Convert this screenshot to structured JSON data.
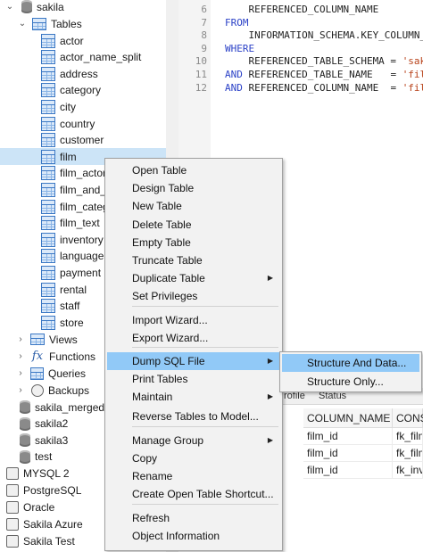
{
  "tree": {
    "db_name": "sakila",
    "tables_label": "Tables",
    "tables": [
      "actor",
      "actor_name_split",
      "address",
      "category",
      "city",
      "country",
      "customer",
      "film",
      "film_actor",
      "film_and_a",
      "film_categ",
      "film_text",
      "inventory",
      "language",
      "payment",
      "rental",
      "staff",
      "store"
    ],
    "views_label": "Views",
    "functions_label": "Functions",
    "queries_label": "Queries",
    "backups_label": "Backups",
    "other_dbs": [
      "sakila_merged",
      "sakila2",
      "sakila3",
      "test"
    ],
    "connections": [
      "MYSQL 2",
      "PostgreSQL",
      "Oracle",
      "Sakila Azure",
      "Sakila Test"
    ]
  },
  "editor": {
    "line_numbers": [
      "6",
      "7",
      "8",
      "9",
      "10",
      "11",
      "12"
    ],
    "lines": [
      {
        "a": "    REFERENCED_COLUMN_NAME",
        "b": "",
        "c": ""
      },
      {
        "a": "",
        "b": "FROM",
        "c": ""
      },
      {
        "a": "    INFORMATION_SCHEMA.KEY_COLUMN_",
        "b": "",
        "c": ""
      },
      {
        "a": "",
        "b": "WHERE",
        "c": ""
      },
      {
        "a": "    REFERENCED_TABLE_SCHEMA = ",
        "b": "",
        "c": "'saki"
      },
      {
        "a": " REFERENCED_TABLE_NAME   = ",
        "b": "AND",
        "c": "'fil"
      },
      {
        "a": " REFERENCED_COLUMN_NAME  = ",
        "b": "AND",
        "c": "'fil"
      }
    ]
  },
  "results": {
    "tabs": [
      "rofile",
      "Status"
    ],
    "columns": [
      "COLUMN_NAME",
      "CONS"
    ],
    "rows": [
      [
        "film_id",
        "fk_film"
      ],
      [
        "film_id",
        "fk_film"
      ],
      [
        "film_id",
        "fk_inv"
      ]
    ]
  },
  "context_menu": {
    "items": [
      {
        "label": "Open Table",
        "submenu": false
      },
      {
        "label": "Design Table",
        "submenu": false
      },
      {
        "label": "New Table",
        "submenu": false
      },
      {
        "label": "Delete Table",
        "submenu": false
      },
      {
        "label": "Empty Table",
        "submenu": false
      },
      {
        "label": "Truncate Table",
        "submenu": false
      },
      {
        "label": "Duplicate Table",
        "submenu": true
      },
      {
        "label": "Set Privileges",
        "submenu": false
      },
      {
        "label": "Import Wizard...",
        "submenu": false
      },
      {
        "label": "Export Wizard...",
        "submenu": false
      },
      {
        "label": "Dump SQL File",
        "submenu": true
      },
      {
        "label": "Print Tables",
        "submenu": false
      },
      {
        "label": "Maintain",
        "submenu": true
      },
      {
        "label": "Reverse Tables to Model...",
        "submenu": false
      },
      {
        "label": "Manage Group",
        "submenu": true
      },
      {
        "label": "Copy",
        "submenu": false
      },
      {
        "label": "Rename",
        "submenu": false
      },
      {
        "label": "Create Open Table Shortcut...",
        "submenu": false
      },
      {
        "label": "Refresh",
        "submenu": false
      },
      {
        "label": "Object Information",
        "submenu": false
      }
    ]
  },
  "submenu": {
    "items": [
      "Structure And Data...",
      "Structure Only..."
    ]
  },
  "colors": {
    "selection": "#cce4f7",
    "menu_highlight": "#91c9f7",
    "keyword": "#2c42c7",
    "string": "#b8431b"
  }
}
